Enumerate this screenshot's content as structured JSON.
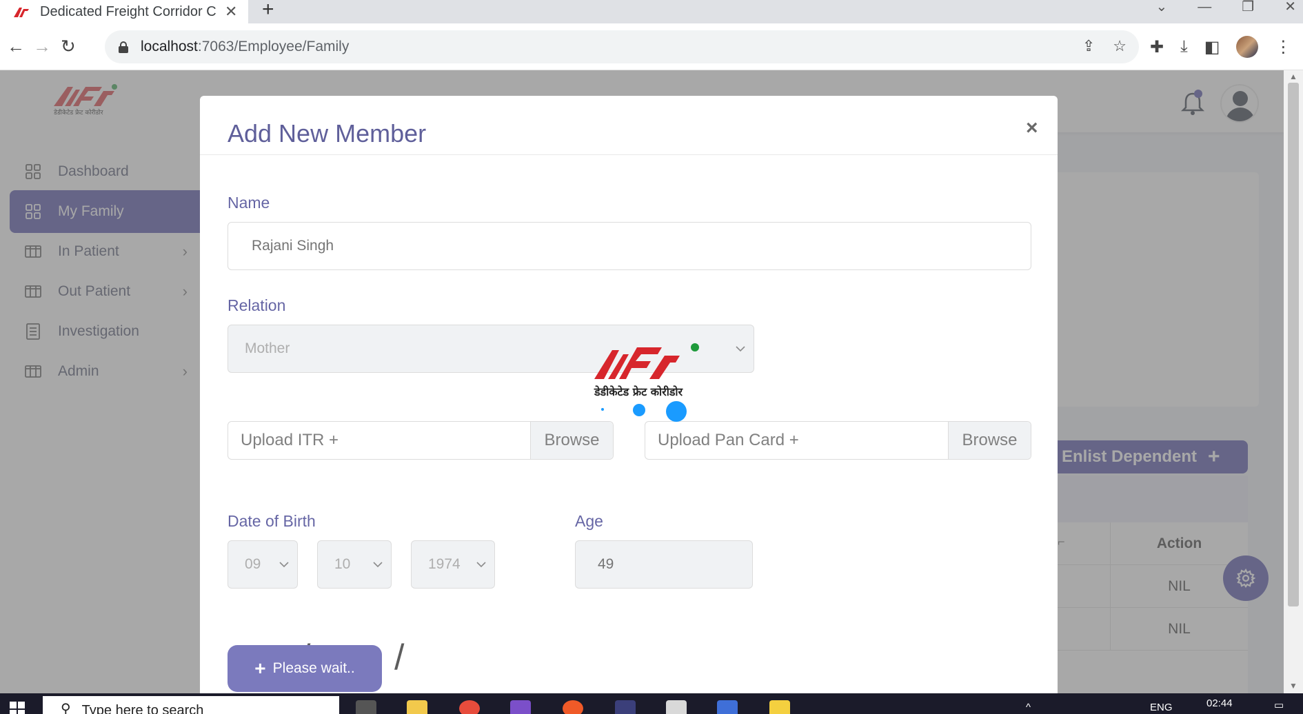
{
  "browser": {
    "tab_title": "Dedicated Freight Corridor Corp",
    "url_host": "localhost",
    "url_path": ":7063/Employee/Family"
  },
  "app": {
    "logo_text": "डेडीकेटेड फ्रेट कोरीडोर",
    "sidebar": {
      "items": [
        {
          "label": "Dashboard",
          "icon": "grid-icon"
        },
        {
          "label": "My Family",
          "icon": "grid-icon",
          "active": true
        },
        {
          "label": "In Patient",
          "icon": "columns-icon",
          "has_submenu": true
        },
        {
          "label": "Out Patient",
          "icon": "columns-icon",
          "has_submenu": true
        },
        {
          "label": "Investigation",
          "icon": "document-icon"
        },
        {
          "label": "Admin",
          "icon": "columns-icon",
          "has_submenu": true
        }
      ]
    },
    "enlist_button_label": "Enlist Dependent",
    "table": {
      "action_header": "Action",
      "rows": [
        {
          "action": "NIL"
        },
        {
          "action": "NIL"
        }
      ]
    }
  },
  "modal": {
    "title": "Add New Member",
    "close_symbol": "×",
    "name_label": "Name",
    "name_value": "Rajani Singh",
    "relation_label": "Relation",
    "relation_value": "Mother",
    "upload_itr_label": "Upload ITR +",
    "upload_pan_label": "Upload Pan Card +",
    "browse_label": "Browse",
    "dob_label": "Date of Birth",
    "dob_day": "09",
    "dob_month": "10",
    "dob_year": "1974",
    "dob_separator": "/",
    "age_label": "Age",
    "age_value": "49",
    "submit_label": "Please wait.."
  },
  "loader": {
    "logo_text": "डेडीकेटेड फ्रेट कोरीडोर"
  },
  "taskbar": {
    "search_placeholder": "Type here to search",
    "time": "02:44",
    "lang": "ENG"
  },
  "colors": {
    "primary": "#3d3b9e",
    "title": "#14146b",
    "logo_red": "#d7262c",
    "loader_blue": "#1a9bff"
  }
}
